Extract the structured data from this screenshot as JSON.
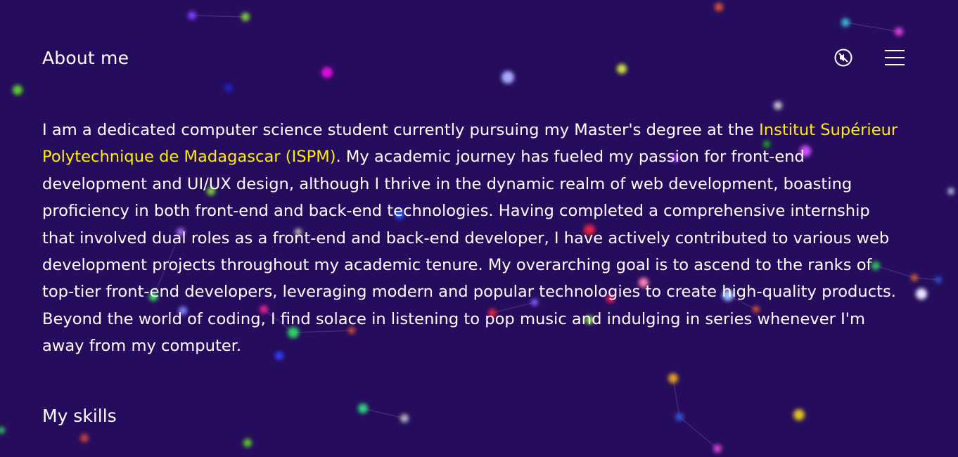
{
  "header": {
    "section_title": "About me",
    "sound_icon": "sound-mute-icon",
    "menu_icon": "hamburger-menu-icon"
  },
  "about": {
    "text_before": "I am a dedicated computer science student currently pursuing my Master's degree at the ",
    "institution": "Institut Supérieur Polytechnique de Madagascar (ISPM)",
    "text_after": ". My academic journey has fueled my passion for front-end development and UI/UX design, although I thrive in the dynamic realm of web development, boasting proficiency in both front-end and back-end technologies. Having completed a comprehensive internship that involved dual roles as a front-end and back-end developer, I have actively contributed to various web development projects throughout my academic tenure. My overarching goal is to ascend to the ranks of top-tier front-end developers, leveraging modern and popular technologies to create high-quality products. Beyond the world of coding, I find solace in listening to pop music and indulging in series whenever I'm away from my computer."
  },
  "skills": {
    "title": "My skills"
  },
  "colors": {
    "background": "#250c5c",
    "text": "#ffffff",
    "highlight": "#ffee00"
  }
}
